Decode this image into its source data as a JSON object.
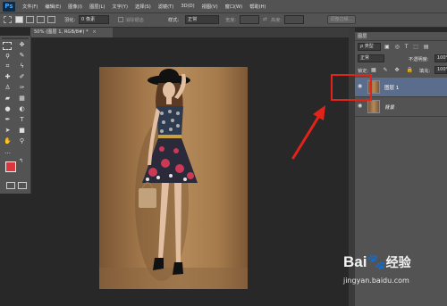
{
  "app": {
    "logo": "Ps"
  },
  "menu": [
    "文件(F)",
    "编辑(E)",
    "图像(I)",
    "图层(L)",
    "文字(Y)",
    "选择(S)",
    "滤镜(T)",
    "3D(D)",
    "视图(V)",
    "窗口(W)",
    "帮助(H)"
  ],
  "options": {
    "feather_label": "羽化:",
    "feather_value": "0 像素",
    "antialias_label": "消除锯齿",
    "style_label": "样式:",
    "style_value": "正常",
    "width_label": "宽度:",
    "height_label": "高度:",
    "refine_button": "调整边缘..."
  },
  "document": {
    "tab_label": "50% (图层 1, RGB/8#) *",
    "close": "×"
  },
  "layers_panel": {
    "title": "图层",
    "kind_select": "ρ 类型",
    "blend_mode": "正常",
    "opacity_label": "不透明度:",
    "opacity_value": "100%",
    "lock_label": "锁定:",
    "fill_label": "填充:",
    "fill_value": "100%",
    "layers": [
      {
        "name": "图层 1",
        "selected": true
      },
      {
        "name": "背景",
        "selected": false
      }
    ]
  },
  "annotation": {
    "highlight_color": "#e2231a"
  },
  "watermark": {
    "brand": "Bai",
    "brand2": "经验",
    "url": "jingyan.baidu.com"
  },
  "colors": {
    "foreground": "#d9373c",
    "background": "#ffffff",
    "selected_row": "#5a6d8c"
  }
}
